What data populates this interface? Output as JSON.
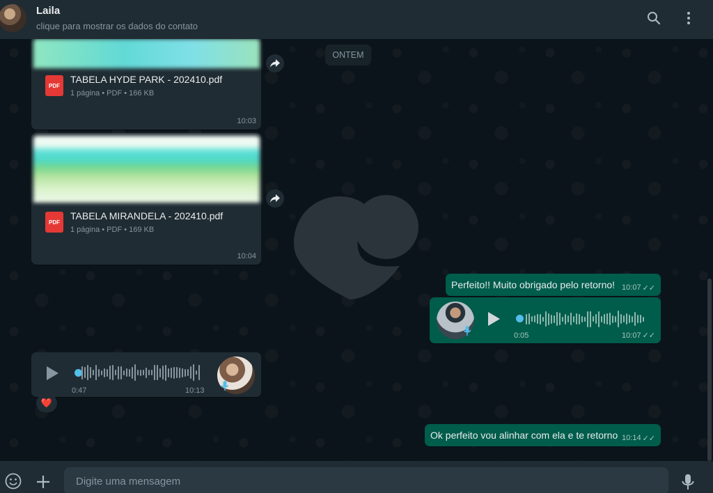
{
  "header": {
    "contact_name": "Laila",
    "contact_subtitle": "clique para mostrar os dados do contato"
  },
  "chat": {
    "date_divider": "ONTEM",
    "messages": [
      {
        "type": "document",
        "direction": "incoming",
        "file_name": "TABELA HYDE PARK - 202410.pdf",
        "meta": "1 página • PDF • 166 KB",
        "pdf_label": "PDF",
        "time": "10:03"
      },
      {
        "type": "document",
        "direction": "incoming",
        "file_name": "TABELA MIRANDELA - 202410.pdf",
        "meta": "1 página • PDF • 169 KB",
        "pdf_label": "PDF",
        "time": "10:04"
      },
      {
        "type": "text",
        "direction": "outgoing",
        "text": "Perfeito!! Muito obrigado pelo retorno!",
        "time": "10:07",
        "status": "read"
      },
      {
        "type": "audio",
        "direction": "outgoing",
        "duration": "0:05",
        "time": "10:07",
        "status": "read"
      },
      {
        "type": "audio",
        "direction": "incoming",
        "duration": "0:47",
        "time": "10:13",
        "reaction": "❤️"
      },
      {
        "type": "text",
        "direction": "outgoing",
        "text": "Ok perfeito vou alinhar com ela e te retorno",
        "time": "10:14",
        "status": "read"
      }
    ]
  },
  "composer": {
    "placeholder": "Digite uma mensagem"
  },
  "icons": {
    "search": "search-icon",
    "menu": "menu-dots-icon",
    "emoji": "emoji-icon",
    "attach": "plus-icon",
    "mic": "mic-icon",
    "forward": "forward-icon",
    "play": "play-icon"
  },
  "colors": {
    "outgoing_bubble": "#005c4b",
    "incoming_bubble": "#202c33",
    "background": "#0b141a",
    "audio_dot": "#53bdeb"
  }
}
